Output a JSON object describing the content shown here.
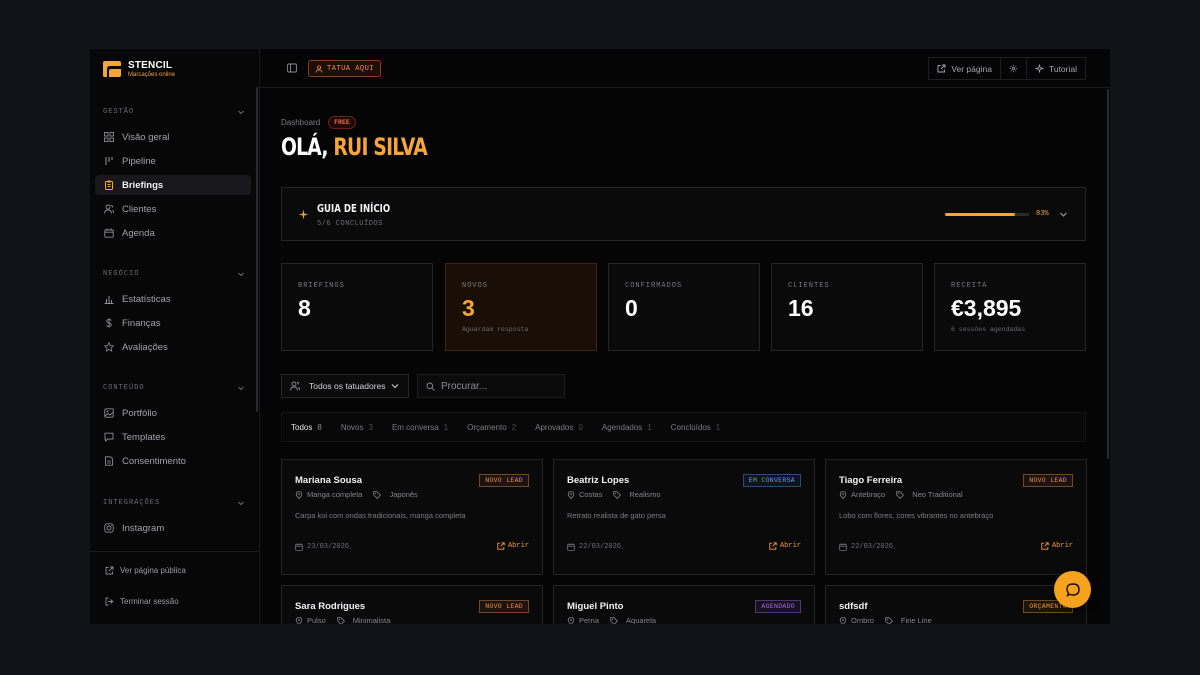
{
  "brand": {
    "name": "STENCIL",
    "tagline": "Marcações online",
    "accent": "#f5a53a"
  },
  "sidebar": {
    "sections": [
      {
        "title": "GESTÃO",
        "items": [
          {
            "label": "Visão geral",
            "icon": "grid-icon"
          },
          {
            "label": "Pipeline",
            "icon": "pipeline-icon"
          },
          {
            "label": "Briefings",
            "icon": "clipboard-icon",
            "active": true
          },
          {
            "label": "Clientes",
            "icon": "users-icon"
          },
          {
            "label": "Agenda",
            "icon": "calendar-icon"
          }
        ]
      },
      {
        "title": "NEGÓCIO",
        "items": [
          {
            "label": "Estatísticas",
            "icon": "bar-chart-icon"
          },
          {
            "label": "Finanças",
            "icon": "dollar-icon"
          },
          {
            "label": "Avaliações",
            "icon": "star-icon"
          }
        ]
      },
      {
        "title": "CONTEÚDO",
        "items": [
          {
            "label": "Portfólio",
            "icon": "image-icon"
          },
          {
            "label": "Templates",
            "icon": "message-icon"
          },
          {
            "label": "Consentimento",
            "icon": "document-icon"
          }
        ]
      },
      {
        "title": "INTEGRAÇÕES",
        "items": [
          {
            "label": "Instagram",
            "icon": "instagram-icon"
          }
        ]
      }
    ],
    "footer": {
      "public_page": "Ver página pública",
      "logout": "Terminar sessão"
    }
  },
  "topbar": {
    "tatua_label": "TATUA AQUI",
    "view_page": "Ver página",
    "tutorial": "Tutorial"
  },
  "header": {
    "breadcrumb": "Dashboard",
    "plan_badge": "FREE",
    "greeting_prefix": "OLÁ,",
    "greeting_name": "RUI SILVA"
  },
  "guide": {
    "title": "GUIA DE INÍCIO",
    "subtitle": "5/6 CONCLUÍDOS",
    "progress": 0.83,
    "progress_label": "83%"
  },
  "stats": [
    {
      "label": "BRIEFINGS",
      "value": "8",
      "sub": ""
    },
    {
      "label": "NOVOS",
      "value": "3",
      "sub": "Aguardam resposta",
      "highlight": true
    },
    {
      "label": "CONFIRMADOS",
      "value": "0",
      "sub": ""
    },
    {
      "label": "CLIENTES",
      "value": "16",
      "sub": ""
    },
    {
      "label": "RECEITA",
      "value": "€3,895",
      "sub": "6 sessões agendadas"
    }
  ],
  "filters": {
    "artist_select": "Todos os tatuadores",
    "search_placeholder": "Procurar..."
  },
  "tabs": [
    {
      "label": "Todos",
      "count": "8",
      "active": true
    },
    {
      "label": "Novos",
      "count": "3"
    },
    {
      "label": "Em conversa",
      "count": "1"
    },
    {
      "label": "Orçamento",
      "count": "2"
    },
    {
      "label": "Aprovados",
      "count": "0"
    },
    {
      "label": "Agendados",
      "count": "1"
    },
    {
      "label": "Concluídos",
      "count": "1"
    }
  ],
  "cards": [
    {
      "name": "Mariana Sousa",
      "status": "NOVO LEAD",
      "status_color": "#f58c4d",
      "zone": "Manga completa",
      "style": "Japonês",
      "description": "Carpa koi com ondas tradicionais, manga completa",
      "date": "23/03/2026",
      "action": "Abrir"
    },
    {
      "name": "Beatriz Lopes",
      "status": "EM CONVERSA",
      "status_color": "#5b9bf5",
      "zone": "Costas",
      "style": "Realismo",
      "description": "Retrato realista de gato persa",
      "date": "22/03/2026",
      "action": "Abrir"
    },
    {
      "name": "Tiago Ferreira",
      "status": "NOVO LEAD",
      "status_color": "#f58c4d",
      "zone": "Antebraço",
      "style": "Neo Traditional",
      "description": "Lobo com flores, cores vibrantes no antebraço",
      "date": "22/03/2026",
      "action": "Abrir"
    },
    {
      "name": "Sara Rodrigues",
      "status": "NOVO LEAD",
      "status_color": "#f58c4d",
      "zone": "Pulso",
      "style": "Minimalista",
      "description": "",
      "date": "",
      "action": ""
    },
    {
      "name": "Miguel Pinto",
      "status": "AGENDADO",
      "status_color": "#a66bf0",
      "zone": "Perna",
      "style": "Aquarela",
      "description": "",
      "date": "",
      "action": ""
    },
    {
      "name": "sdfsdf",
      "status": "ORÇAMENTO",
      "status_color": "#f59a3a",
      "zone": "Ombro",
      "style": "Fine Line",
      "description": "",
      "date": "",
      "action": ""
    }
  ]
}
